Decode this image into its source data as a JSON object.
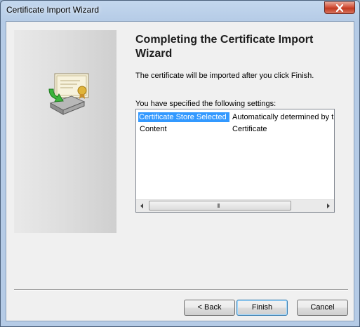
{
  "window": {
    "title": "Certificate Import Wizard"
  },
  "page": {
    "heading": "Completing the Certificate Import Wizard",
    "description": "The certificate will be imported after you click Finish.",
    "settings_label": "You have specified the following settings:"
  },
  "settings": {
    "rows": [
      {
        "name": "Certificate Store Selected",
        "value": "Automatically determined by t"
      },
      {
        "name": "Content",
        "value": "Certificate"
      }
    ]
  },
  "scrollbar": {
    "grip": "III"
  },
  "buttons": {
    "back": "< Back",
    "finish": "Finish",
    "cancel": "Cancel"
  },
  "colors": {
    "selection": "#3399ff",
    "close_button": "#c23a20",
    "default_button_border": "#3c7fb1"
  }
}
